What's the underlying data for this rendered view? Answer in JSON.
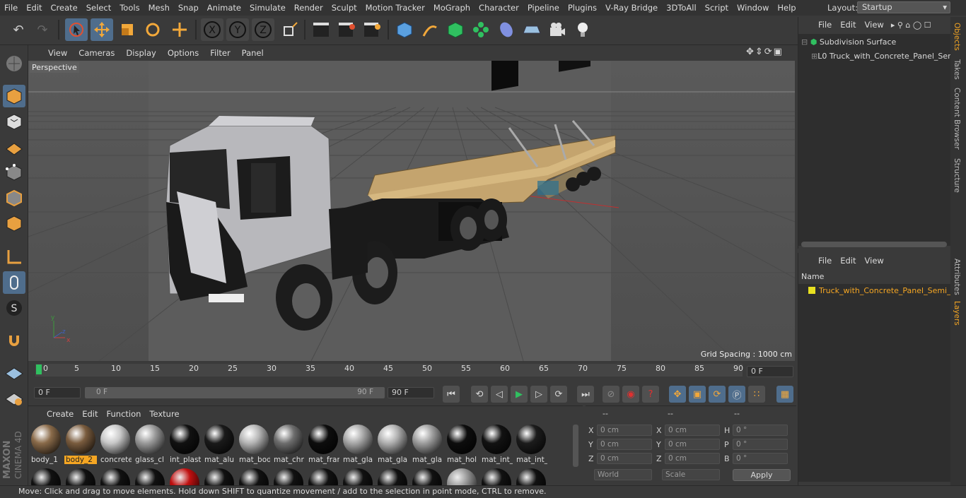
{
  "menubar": {
    "items": [
      "File",
      "Edit",
      "Create",
      "Select",
      "Tools",
      "Mesh",
      "Snap",
      "Animate",
      "Simulate",
      "Render",
      "Sculpt",
      "Motion Tracker",
      "MoGraph",
      "Character",
      "Pipeline",
      "Plugins",
      "V-Ray Bridge",
      "3DToAll",
      "Script",
      "Window",
      "Help"
    ],
    "layout_label": "Layout:",
    "layout_value": "Startup"
  },
  "viewport": {
    "menu": [
      "View",
      "Cameras",
      "Display",
      "Options",
      "Filter",
      "Panel"
    ],
    "label": "Perspective",
    "grid_spacing": "Grid Spacing : 1000 cm"
  },
  "timeline": {
    "ticks": [
      "0",
      "5",
      "10",
      "15",
      "20",
      "25",
      "30",
      "35",
      "40",
      "45",
      "50",
      "55",
      "60",
      "65",
      "70",
      "75",
      "80",
      "85",
      "90"
    ],
    "current_frame": "0 F",
    "start": "0 F",
    "range_start": "0 F",
    "range_end": "90 F",
    "end": "90 F"
  },
  "materials": {
    "menu": [
      "Create",
      "Edit",
      "Function",
      "Texture"
    ],
    "items": [
      {
        "name": "body_1",
        "color": "#8a6b4a"
      },
      {
        "name": "body_2",
        "color": "#7a5c3e"
      },
      {
        "name": "concrete",
        "color": "#c8c8c8"
      },
      {
        "name": "glass_cl",
        "color": "#9a9a9a"
      },
      {
        "name": "int_plast",
        "color": "#111111"
      },
      {
        "name": "mat_alu",
        "color": "#1a1a1a"
      },
      {
        "name": "mat_bod",
        "color": "#b5b5b5"
      },
      {
        "name": "mat_chr",
        "color": "#6e6e6e"
      },
      {
        "name": "mat_fran",
        "color": "#0d0d0d"
      },
      {
        "name": "mat_gla",
        "color": "#a8a8a8"
      },
      {
        "name": "mat_gla",
        "color": "#b0b0b0"
      },
      {
        "name": "mat_gla",
        "color": "#9e9e9e"
      },
      {
        "name": "mat_hol",
        "color": "#0d0d0d"
      },
      {
        "name": "mat_int_",
        "color": "#121212"
      },
      {
        "name": "mat_int_",
        "color": "#1c1c1c"
      }
    ],
    "selected_index": 1
  },
  "coords": {
    "headers": [
      "--",
      "--",
      "--"
    ],
    "rows": [
      {
        "a": "X",
        "av": "0 cm",
        "b": "X",
        "bv": "0 cm",
        "c": "H",
        "cv": "0 °"
      },
      {
        "a": "Y",
        "av": "0 cm",
        "b": "Y",
        "bv": "0 cm",
        "c": "P",
        "cv": "0 °"
      },
      {
        "a": "Z",
        "av": "0 cm",
        "b": "Z",
        "bv": "0 cm",
        "c": "B",
        "cv": "0 °"
      }
    ],
    "world": "World",
    "scale": "Scale",
    "apply": "Apply"
  },
  "objects": {
    "menu": [
      "File",
      "Edit",
      "View"
    ],
    "items": [
      "Subdivision Surface",
      "Truck_with_Concrete_Panel_Semi"
    ]
  },
  "layers": {
    "menu": [
      "File",
      "Edit",
      "View"
    ],
    "column": "Name",
    "items": [
      "Truck_with_Concrete_Panel_Semi_"
    ]
  },
  "sidetabs": [
    "Objects",
    "Takes",
    "Content Browser",
    "Structure",
    "Attributes",
    "Layers"
  ],
  "status": "Move: Click and drag to move elements. Hold down SHIFT to quantize movement / add to the selection in point mode, CTRL to remove.",
  "brand": {
    "line1": "MAXON",
    "line2": "CINEMA 4D"
  },
  "colors": {
    "accent": "#f5a623",
    "selection": "#4f6d8c",
    "truck_body": "#b8b8bc",
    "trailer": "#c8a870"
  }
}
